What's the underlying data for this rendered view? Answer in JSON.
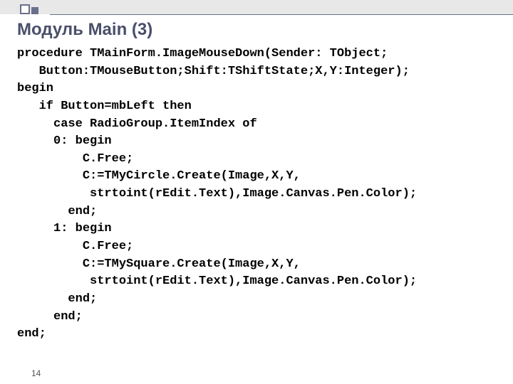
{
  "header": {
    "title": "Модуль Main (3)"
  },
  "code": {
    "l0": "procedure TMainForm.ImageMouseDown(Sender: TObject;",
    "l1": "   Button:TMouseButton;Shift:TShiftState;X,Y:Integer);",
    "l2": "begin",
    "l3": "   if Button=mbLeft then",
    "l4": "     case RadioGroup.ItemIndex of",
    "l5": "     0: begin",
    "l6": "         C.Free;",
    "l7": "         C:=TMyCircle.Create(Image,X,Y,",
    "l8": "          strtoint(rEdit.Text),Image.Canvas.Pen.Color);",
    "l9": "       end;",
    "l10": "     1: begin",
    "l11": "         C.Free;",
    "l12": "         C:=TMySquare.Create(Image,X,Y,",
    "l13": "          strtoint(rEdit.Text),Image.Canvas.Pen.Color);",
    "l14": "       end;",
    "l15": "     end;",
    "l16": "end;"
  },
  "page": {
    "number": "14"
  }
}
